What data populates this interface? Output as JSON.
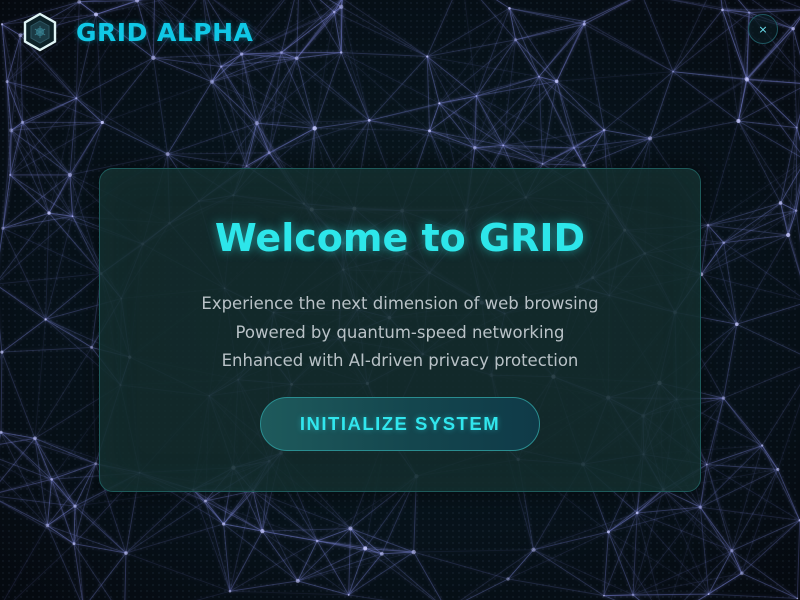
{
  "app": {
    "brand": "GRID ALPHA",
    "logo_icon": "hexagon-logo-icon",
    "close_label": "×"
  },
  "welcome": {
    "title": "Welcome to GRID",
    "lines": [
      "Experience the next dimension of web browsing",
      "Powered by quantum-speed networking",
      "Enhanced with AI-driven privacy protection"
    ],
    "button_label": "INITIALIZE SYSTEM"
  },
  "colors": {
    "accent": "#10c8e6",
    "title": "#2de6ea",
    "body_text": "#b9c2c7",
    "card_background": "#142c2c",
    "network_lines": "#7a82d6",
    "page_background": "#060d12"
  }
}
